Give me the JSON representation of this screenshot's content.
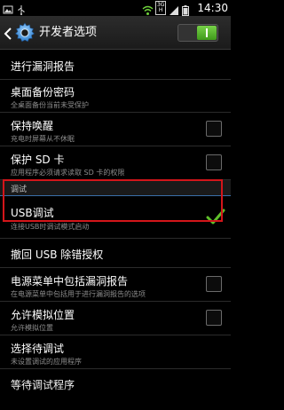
{
  "status_bar": {
    "badge_top": "3G",
    "badge_bottom": "H",
    "time": "14:30",
    "icons": [
      "image-icon",
      "usb-icon",
      "wifi-icon",
      "signal-icon",
      "battery-icon"
    ]
  },
  "action_bar": {
    "title": "开发者选项",
    "toggle_on": true,
    "icons": [
      "back-icon",
      "gear-icon"
    ]
  },
  "rows": [
    {
      "title": "进行漏洞报告"
    },
    {
      "title": "桌面备份密码",
      "subtitle": "全桌面备份当前未受保护"
    },
    {
      "title": "保持唤醒",
      "subtitle": "充电时屏幕从不休眠",
      "checked": false
    },
    {
      "title": "保护 SD 卡",
      "subtitle": "应用程序必须请求读取 SD 卡的权限",
      "checked": false
    }
  ],
  "section_header": "调试",
  "debug_rows": [
    {
      "title": "USB调试",
      "subtitle": "连接USB时调试模式启动",
      "checked": true
    },
    {
      "title": "撤回 USB 除错授权"
    },
    {
      "title": "电源菜单中包括漏洞报告",
      "subtitle": "在电源菜单中包括用于进行漏洞报告的选项",
      "checked": false
    },
    {
      "title": "允许模拟位置",
      "subtitle": "允许模拟位置",
      "checked": false
    },
    {
      "title": "选择待调试",
      "subtitle": "未设置调试的应用程序"
    },
    {
      "title": "等待调试程序"
    }
  ],
  "colors": {
    "highlight": "#d3151a",
    "check": "#5fbf2a",
    "section_line": "#3a6ea8"
  }
}
